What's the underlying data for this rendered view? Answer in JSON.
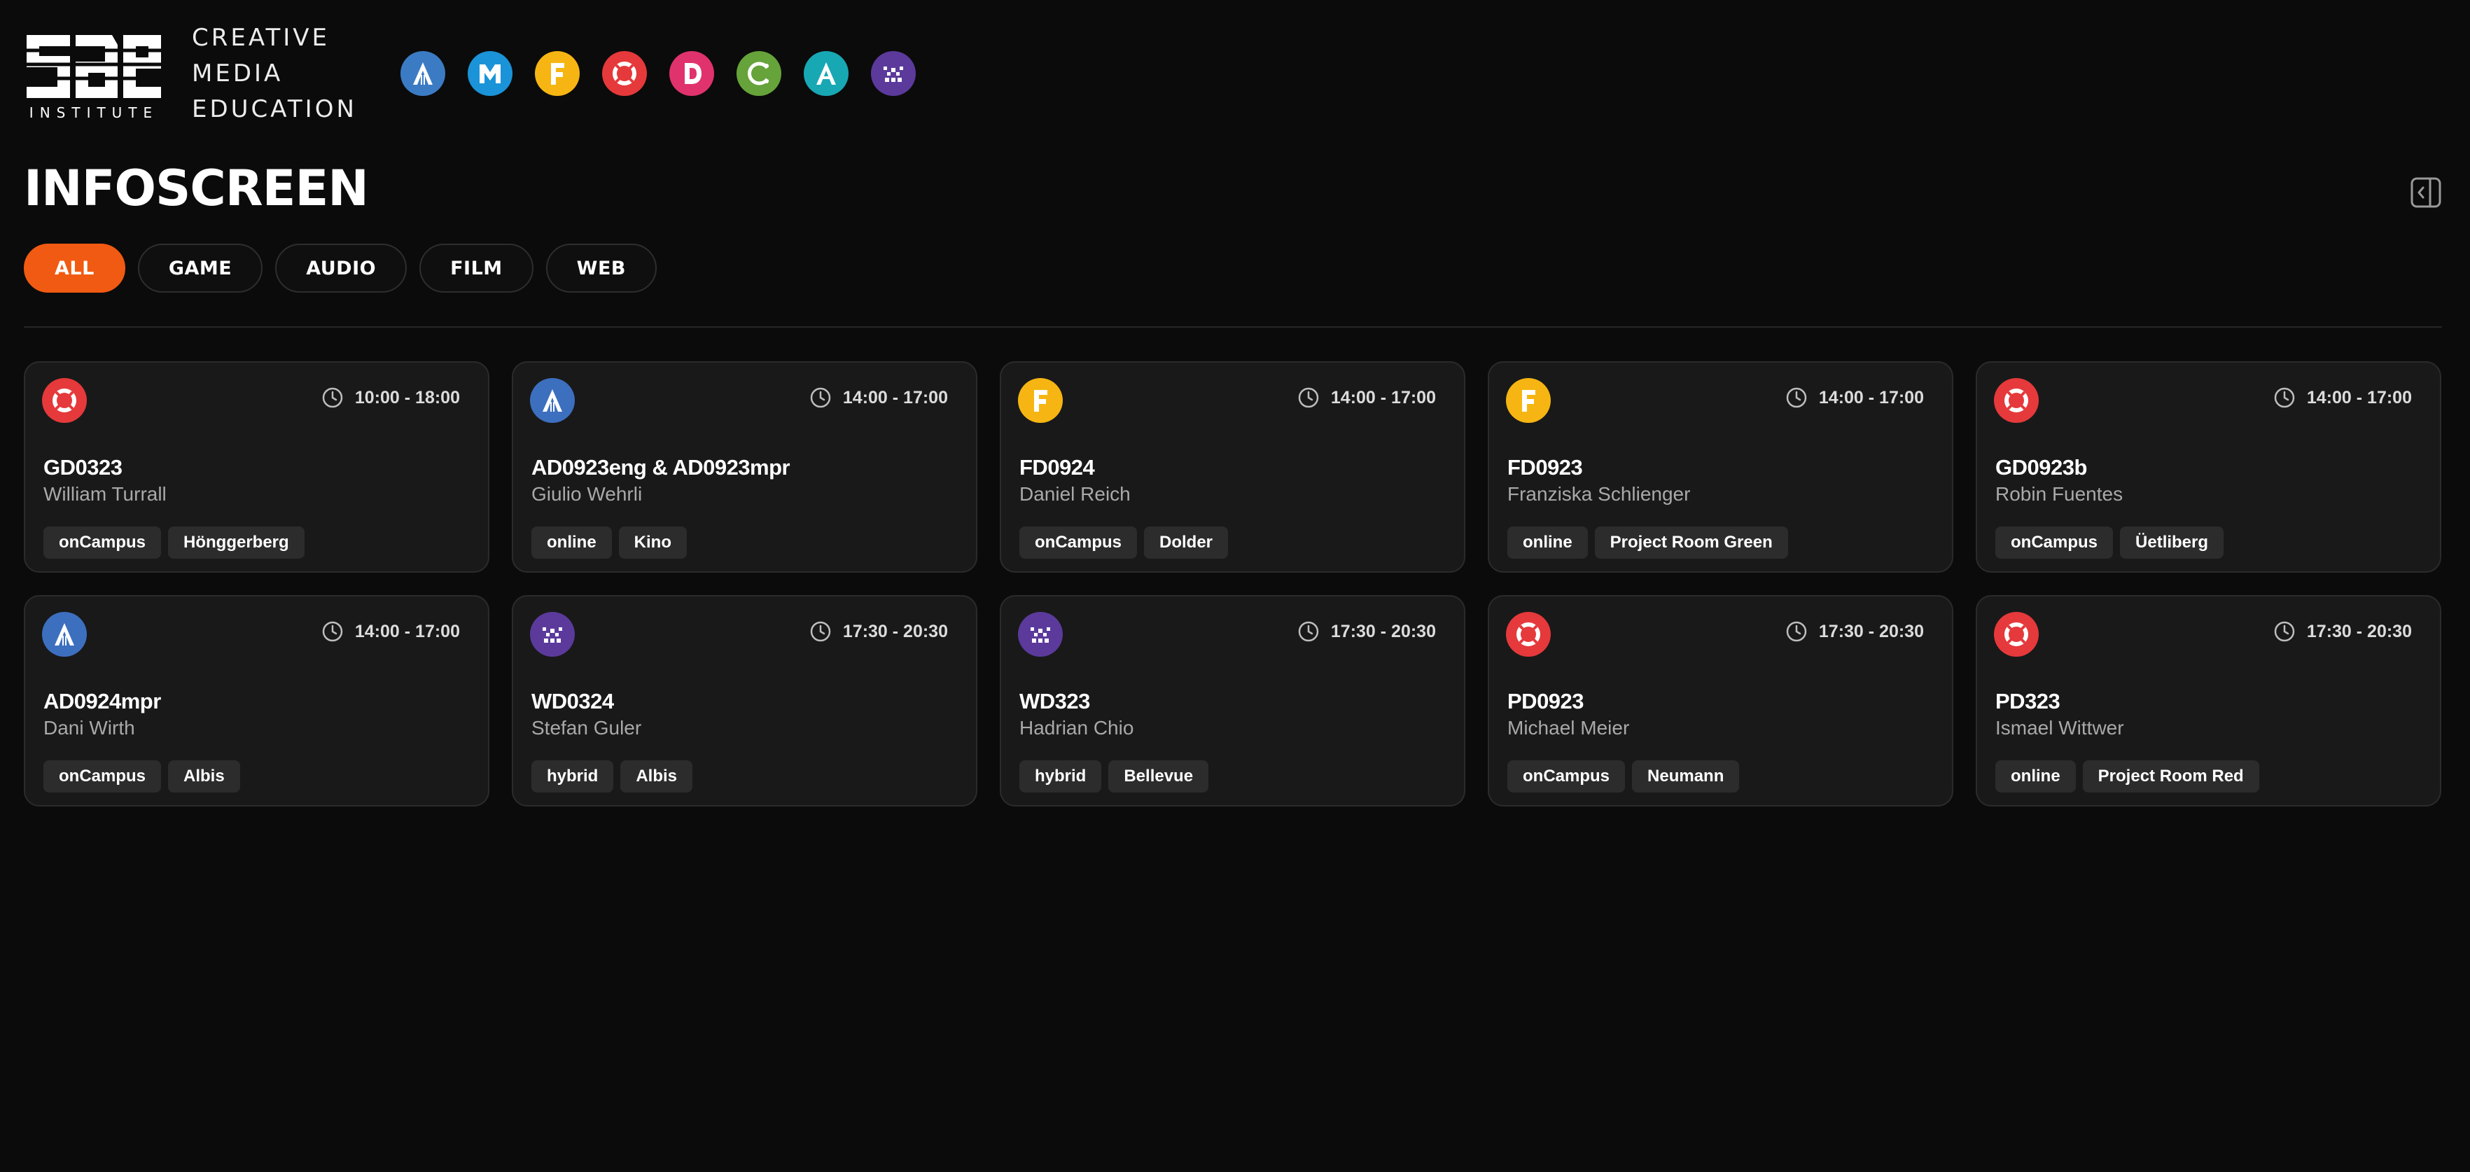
{
  "header": {
    "brand_lines": [
      "CREATIVE",
      "MEDIA",
      "EDUCATION"
    ],
    "logo_subtext": "INSTITUTE",
    "departments": [
      {
        "icon": "audio-icon",
        "color": "#3b7bc4"
      },
      {
        "icon": "media-icon",
        "color": "#1b93d8"
      },
      {
        "icon": "film-icon",
        "color": "#f6b512"
      },
      {
        "icon": "game-icon",
        "color": "#e5393b"
      },
      {
        "icon": "design-icon",
        "color": "#e0326d"
      },
      {
        "icon": "animation-icon",
        "color": "#66a33a"
      },
      {
        "icon": "vfx-icon",
        "color": "#18a8b4"
      },
      {
        "icon": "web-icon",
        "color": "#5b3a9b"
      }
    ]
  },
  "page_title": "INFOSCREEN",
  "filters": [
    {
      "label": "ALL",
      "active": true
    },
    {
      "label": "GAME",
      "active": false
    },
    {
      "label": "AUDIO",
      "active": false
    },
    {
      "label": "FILM",
      "active": false
    },
    {
      "label": "WEB",
      "active": false
    }
  ],
  "colors": {
    "accent": "#f15a12",
    "game": "#e5393b",
    "audio": "#3d6fbf",
    "film": "#f6b512",
    "web": "#5b3a9b"
  },
  "cards": [
    {
      "dept": "game",
      "time": "10:00 - 18:00",
      "course": "GD0323",
      "lecturer": "William Turrall",
      "tags": [
        "onCampus",
        "Hönggerberg"
      ]
    },
    {
      "dept": "audio",
      "time": "14:00 - 17:00",
      "course": "AD0923eng & AD0923mpr",
      "lecturer": "Giulio Wehrli",
      "tags": [
        "online",
        "Kino"
      ]
    },
    {
      "dept": "film",
      "time": "14:00 - 17:00",
      "course": "FD0924",
      "lecturer": "Daniel Reich",
      "tags": [
        "onCampus",
        "Dolder"
      ]
    },
    {
      "dept": "film",
      "time": "14:00 - 17:00",
      "course": "FD0923",
      "lecturer": "Franziska Schlienger",
      "tags": [
        "online",
        "Project Room Green"
      ]
    },
    {
      "dept": "game",
      "time": "14:00 - 17:00",
      "course": "GD0923b",
      "lecturer": "Robin Fuentes",
      "tags": [
        "onCampus",
        "Üetliberg"
      ]
    },
    {
      "dept": "audio",
      "time": "14:00 - 17:00",
      "course": "AD0924mpr",
      "lecturer": "Dani Wirth",
      "tags": [
        "onCampus",
        "Albis"
      ]
    },
    {
      "dept": "web",
      "time": "17:30 - 20:30",
      "course": "WD0324",
      "lecturer": "Stefan Guler",
      "tags": [
        "hybrid",
        "Albis"
      ]
    },
    {
      "dept": "web",
      "time": "17:30 - 20:30",
      "course": "WD323",
      "lecturer": "Hadrian Chio",
      "tags": [
        "hybrid",
        "Bellevue"
      ]
    },
    {
      "dept": "game",
      "time": "17:30 - 20:30",
      "course": "PD0923",
      "lecturer": "Michael Meier",
      "tags": [
        "onCampus",
        "Neumann"
      ]
    },
    {
      "dept": "game",
      "time": "17:30 - 20:30",
      "course": "PD323",
      "lecturer": "Ismael Wittwer",
      "tags": [
        "online",
        "Project Room Red"
      ]
    }
  ]
}
